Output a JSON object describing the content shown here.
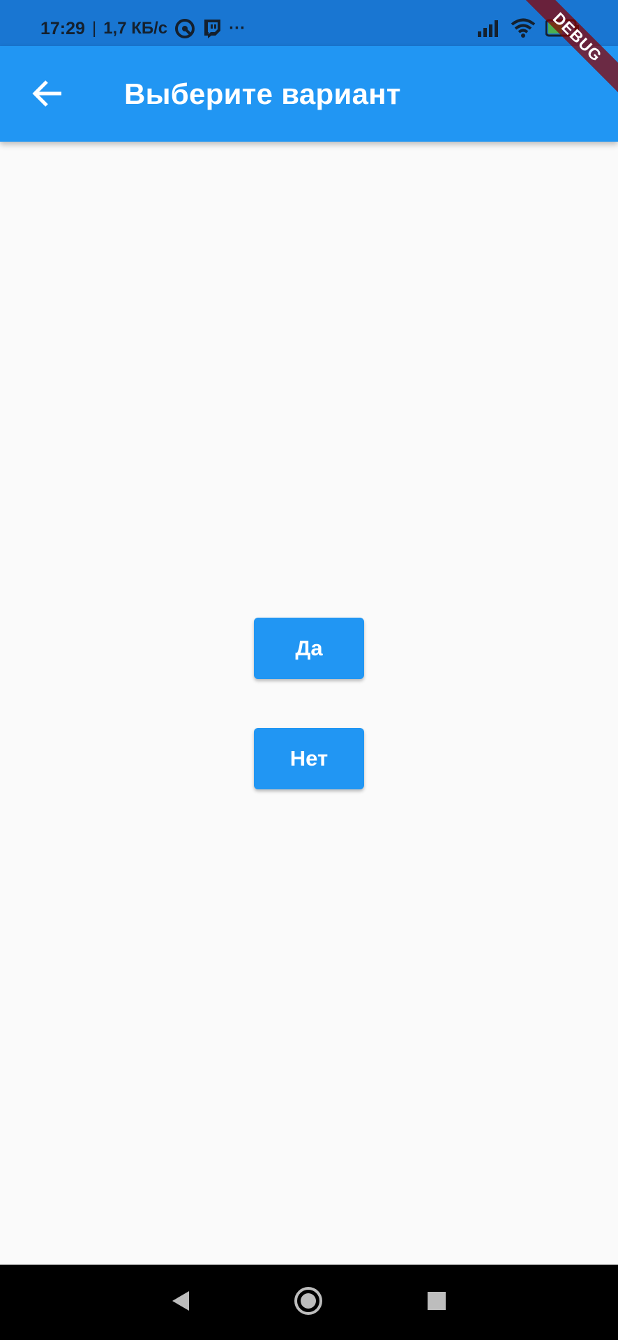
{
  "status_bar": {
    "time": "17:29",
    "separator": "|",
    "net_speed": "1,7 КБ/с",
    "more": "···",
    "battery_level": "52"
  },
  "app_bar": {
    "title": "Выберите вариант",
    "back_icon": "arrow-back-icon"
  },
  "debug_banner": {
    "label": "DEBUG"
  },
  "choices": {
    "yes_label": "Да",
    "no_label": "Нет"
  },
  "nav_bar": {
    "back_icon": "nav-back-icon",
    "home_icon": "nav-home-icon",
    "recent_icon": "nav-recent-icon"
  },
  "colors": {
    "primary": "#2196f3",
    "status_bar": "#1976d2",
    "background": "#fafafa",
    "debug": "#880000"
  }
}
